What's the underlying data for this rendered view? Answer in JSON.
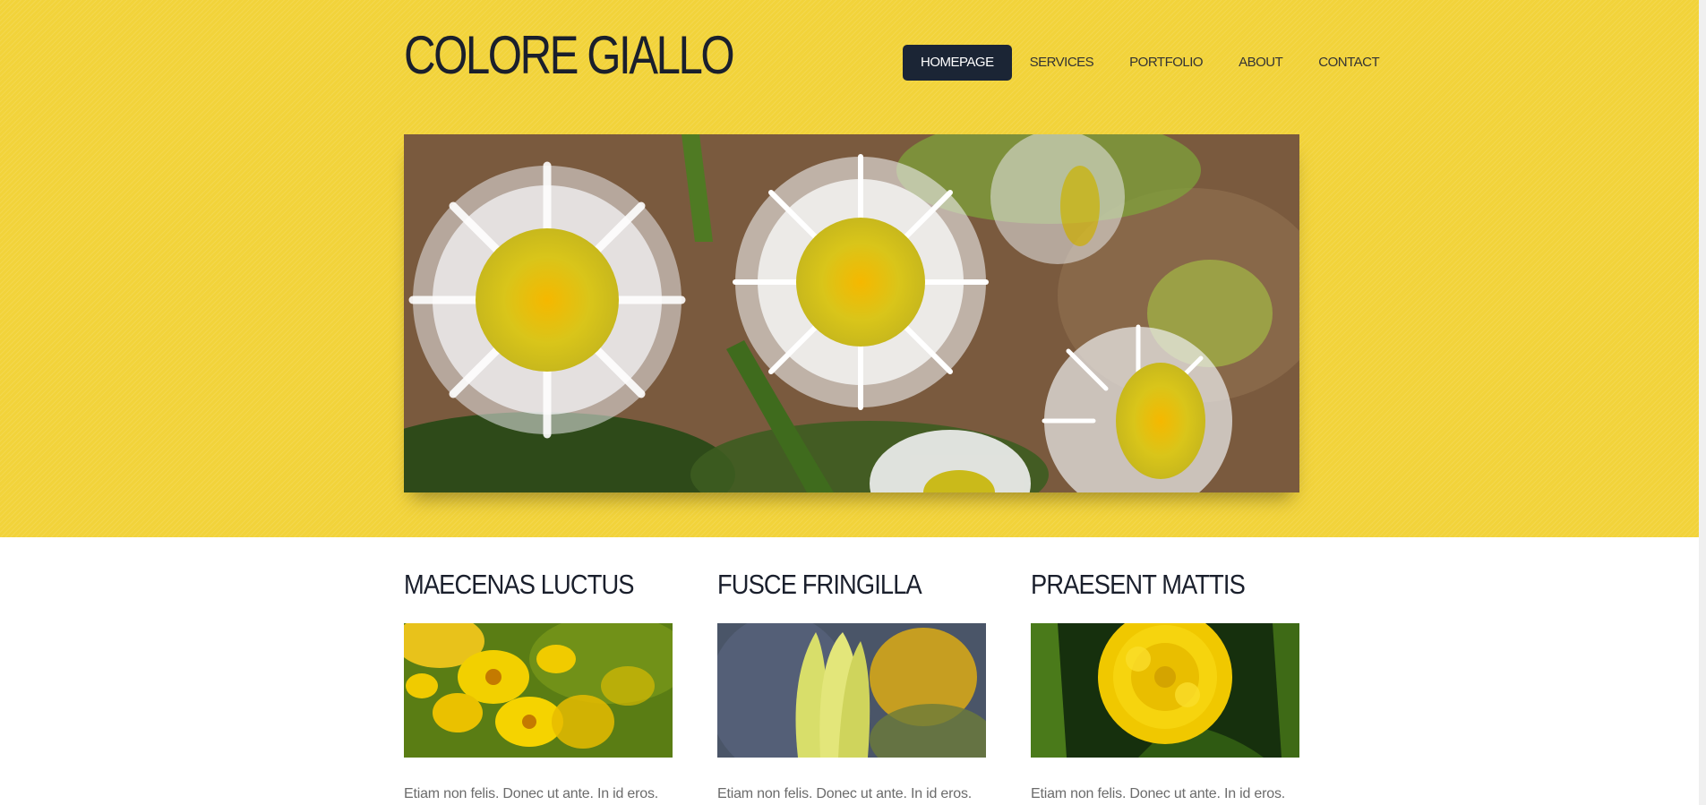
{
  "site": {
    "title": "COLORE GIALLO",
    "accent_color": "#f2d33a",
    "nav_active_color": "#1b2535"
  },
  "nav": {
    "items": [
      {
        "label": "HOMEPAGE",
        "active": true
      },
      {
        "label": "SERVICES",
        "active": false
      },
      {
        "label": "PORTFOLIO",
        "active": false
      },
      {
        "label": "ABOUT",
        "active": false
      },
      {
        "label": "CONTACT",
        "active": false
      }
    ]
  },
  "hero": {
    "image": "white-daisies-photo"
  },
  "columns": [
    {
      "title": "MAECENAS LUCTUS",
      "image": "yellow-daisies-photo",
      "text": "Etiam non felis. Donec ut ante. In id eros."
    },
    {
      "title": "FUSCE FRINGILLA",
      "image": "yellow-tulip-photo",
      "text": "Etiam non felis. Donec ut ante. In id eros."
    },
    {
      "title": "PRAESENT MATTIS",
      "image": "marigold-photo",
      "text": "Etiam non felis. Donec ut ante. In id eros."
    }
  ]
}
